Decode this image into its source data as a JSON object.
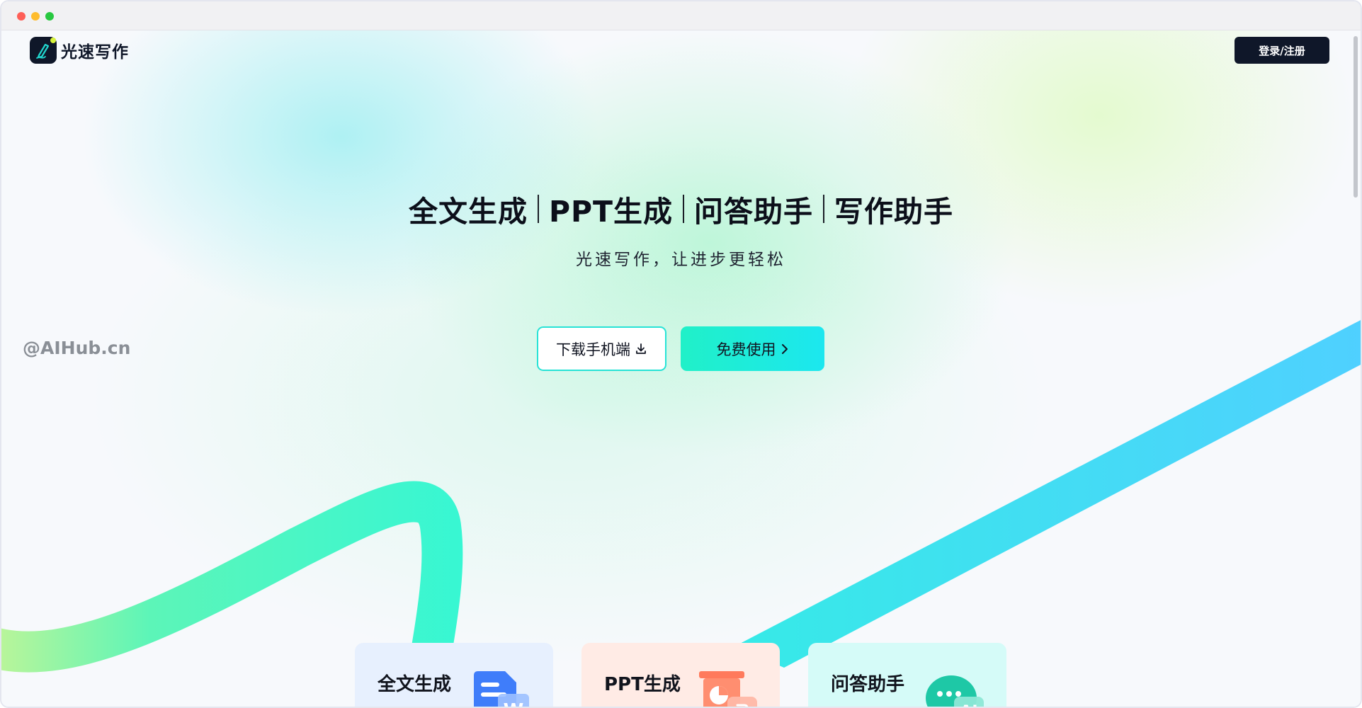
{
  "header": {
    "logo_text": "光速写作",
    "login_label": "登录/注册"
  },
  "hero": {
    "title_segments": [
      "全文生成",
      "PPT生成",
      "问答助手",
      "写作助手"
    ],
    "subtitle": "光速写作，让进步更轻松"
  },
  "actions": {
    "download_label": "下载手机端",
    "free_label": "免费使用"
  },
  "watermark": "@AIHub.cn",
  "cards": [
    {
      "title": "全文生成",
      "icon": "document-word-icon"
    },
    {
      "title": "PPT生成",
      "icon": "presentation-chart-icon"
    },
    {
      "title": "问答助手",
      "icon": "ai-chat-bubble-icon"
    }
  ],
  "colors": {
    "brand_dark": "#0f1729",
    "accent_cyan": "#1ce7ef",
    "accent_green": "#20f0c8",
    "ribbon_blue": "#4fd0ff"
  }
}
